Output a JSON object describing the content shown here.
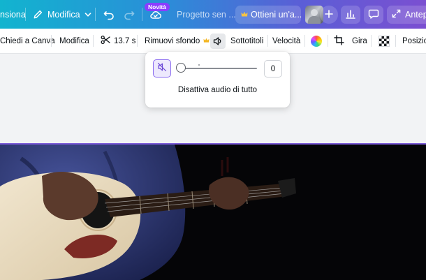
{
  "topbar": {
    "extension_label": "nsiona",
    "edit_label": "Modifica",
    "new_badge": "Novità",
    "project_title": "Progetto sen ...",
    "upgrade_label": "Ottieni un'a...",
    "preview_label": "Antep"
  },
  "toolbar": {
    "ask_canva": "Chiedi a Canva",
    "edit": "Modifica",
    "duration": "13.7 s",
    "remove_bg": "Rimuovi sfondo",
    "subtitles": "Sottotitoli",
    "speed": "Velocità",
    "flip": "Gira",
    "position": "Posizion"
  },
  "audio_popup": {
    "volume_value": "0",
    "volume_level_percent": 0,
    "label": "Disattiva audio di tutto"
  },
  "colors": {
    "accent": "#8b3dff",
    "topbar_start": "#12b4cf",
    "topbar_end": "#7b4fd1"
  }
}
